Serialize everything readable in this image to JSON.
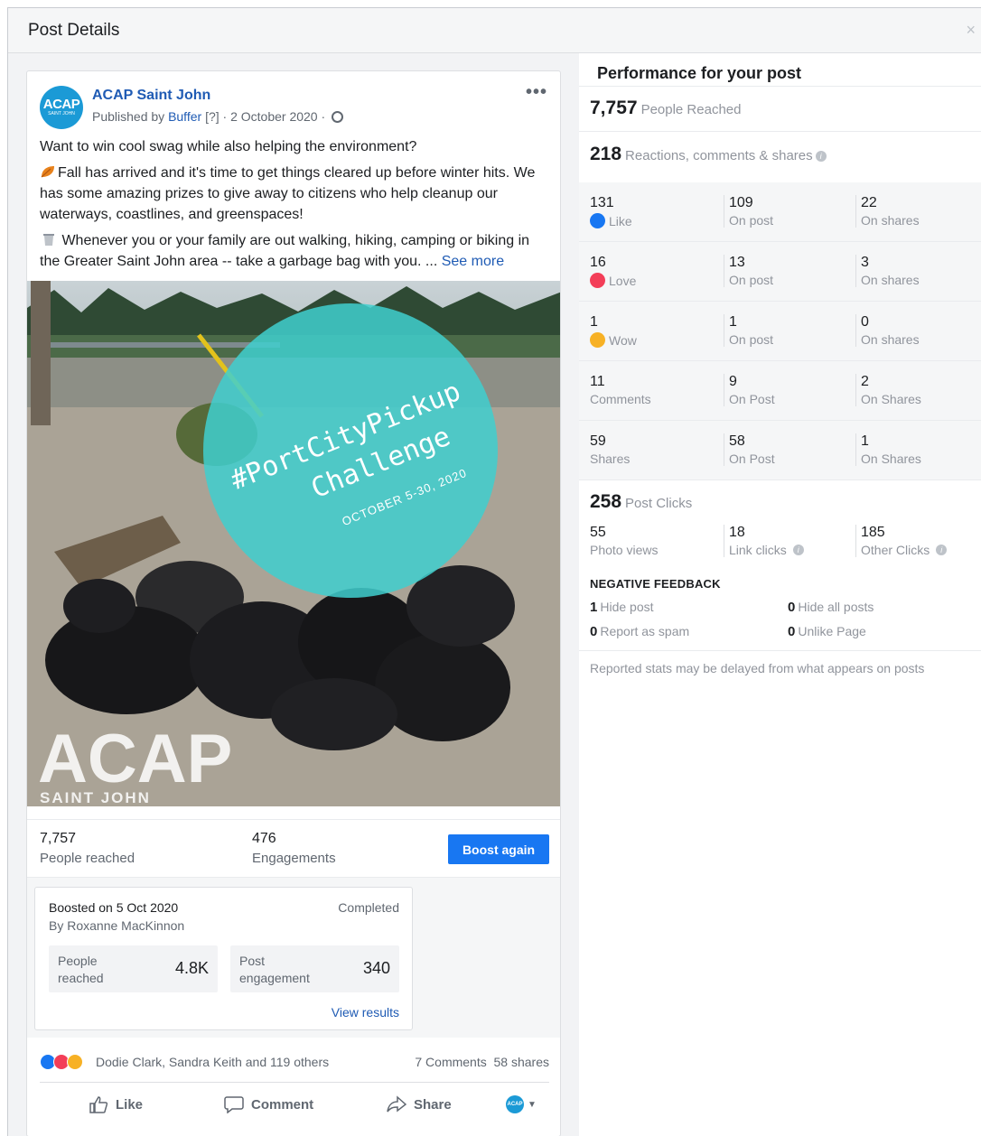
{
  "modal": {
    "title": "Post Details",
    "close_glyph": "×"
  },
  "post": {
    "page_name": "ACAP Saint John",
    "avatar_text": "ACAP",
    "avatar_subtext": "SAINT JOHN",
    "published_prefix": "Published by",
    "publisher": "Buffer",
    "help_marker": "[?]",
    "date": "· 2 October 2020 ·",
    "more_glyph": "•••",
    "text": {
      "line1": "Want to win cool swag while also helping the environment?",
      "para2": "Fall has arrived and it's time to get things cleared up before winter hits. We has some amazing prizes to give away to citizens who help cleanup our waterways, coastlines, and greenspaces!",
      "para3": "Whenever you or your family are out walking, hiking, camping or biking in the Greater Saint John area -- take a garbage bag with you. ...",
      "see_more": "See more"
    },
    "image": {
      "hashtag_line1": "#PortCityPickup",
      "hashtag_line2": "Challenge",
      "dates": "OCTOBER 5-30, 2020",
      "watermark": "ACAP",
      "watermark_sub": "SAINT JOHN",
      "circle_color": "#3fcfcf"
    },
    "stats": {
      "reached_value": "7,757",
      "reached_label": "People reached",
      "engagements_value": "476",
      "engagements_label": "Engagements",
      "boost_button": "Boost again"
    },
    "boost": {
      "boosted_on": "Boosted on 5 Oct 2020",
      "by": "By Roxanne MacKinnon",
      "status": "Completed",
      "people_label": "People reached",
      "people_value": "4.8K",
      "engagement_label": "Post engagement",
      "engagement_value": "340",
      "view_results": "View results"
    },
    "reactions": {
      "names": "Dodie Clark, Sandra Keith and 119 others",
      "comments": "7 Comments",
      "shares": "58 shares"
    },
    "actions": {
      "like": "Like",
      "comment": "Comment",
      "share": "Share",
      "avatar_mini": "ACAP"
    }
  },
  "performance": {
    "title": "Performance for your post",
    "reached_value": "7,757",
    "reached_label": "People Reached",
    "rcs_value": "218",
    "rcs_label": "Reactions, comments & shares",
    "rows": [
      {
        "total": "131",
        "total_label": "Like",
        "post": "109",
        "post_label": "On post",
        "shares": "22",
        "shares_label": "On shares",
        "icon": "like-icon"
      },
      {
        "total": "16",
        "total_label": "Love",
        "post": "13",
        "post_label": "On post",
        "shares": "3",
        "shares_label": "On shares",
        "icon": "love-icon"
      },
      {
        "total": "1",
        "total_label": "Wow",
        "post": "1",
        "post_label": "On post",
        "shares": "0",
        "shares_label": "On shares",
        "icon": "wow-icon"
      },
      {
        "total": "11",
        "total_label": "Comments",
        "post": "9",
        "post_label": "On Post",
        "shares": "2",
        "shares_label": "On Shares",
        "icon": ""
      },
      {
        "total": "59",
        "total_label": "Shares",
        "post": "58",
        "post_label": "On Post",
        "shares": "1",
        "shares_label": "On Shares",
        "icon": ""
      }
    ],
    "clicks_value": "258",
    "clicks_label": "Post Clicks",
    "photo_views": "55",
    "photo_views_label": "Photo views",
    "link_clicks": "18",
    "link_clicks_label": "Link clicks",
    "other_clicks": "185",
    "other_clicks_label": "Other Clicks",
    "negative_title": "NEGATIVE FEEDBACK",
    "hide_post_value": "1",
    "hide_post_label": "Hide post",
    "hide_all_value": "0",
    "hide_all_label": "Hide all posts",
    "spam_value": "0",
    "spam_label": "Report as spam",
    "unlike_value": "0",
    "unlike_label": "Unlike Page",
    "footnote": "Reported stats may be delayed from what appears on posts"
  },
  "colors": {
    "brand_blue": "#1877f2",
    "link_blue": "#1f5bb4",
    "love_red": "#f33e58",
    "wow_yellow": "#f7b125"
  }
}
